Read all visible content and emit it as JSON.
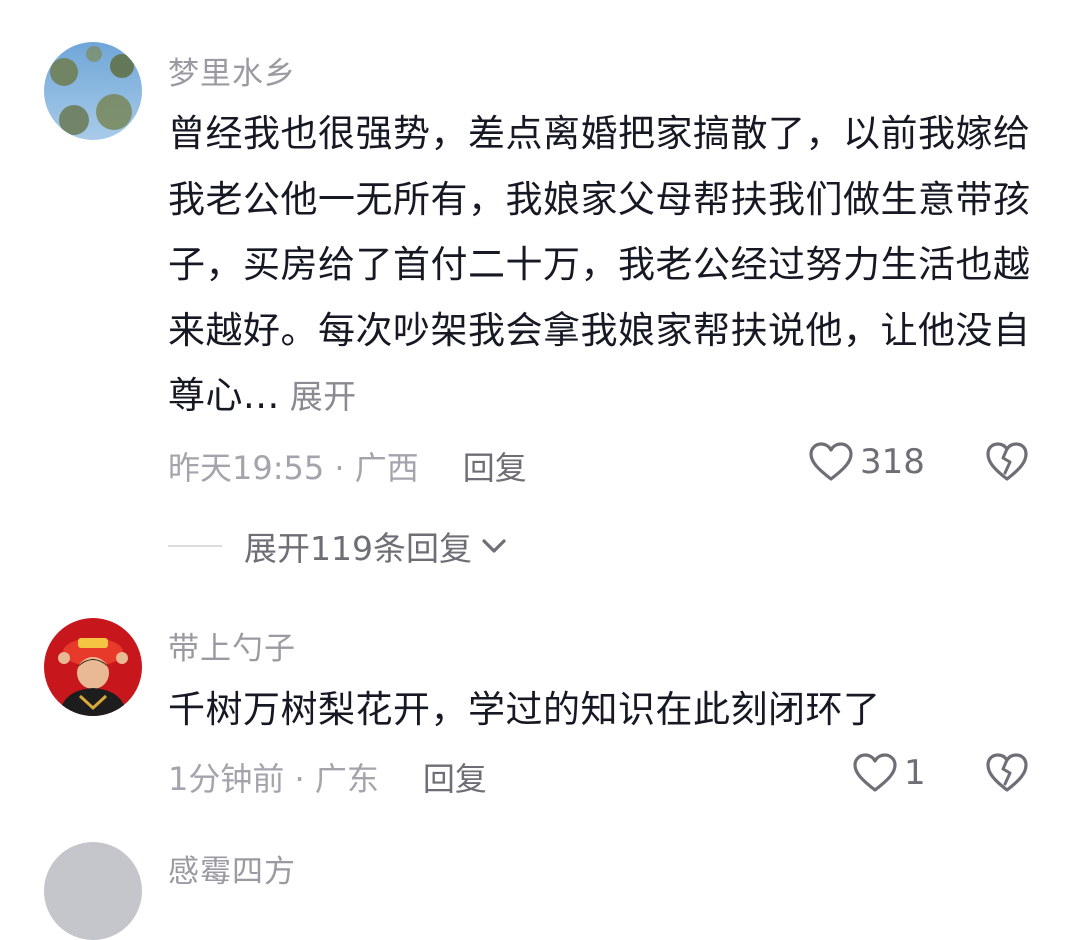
{
  "comments": [
    {
      "username": "梦里水乡",
      "text": "曾经我也很强势，差点离婚把家搞散了，以前我嫁给我老公他一无所有，我娘家父母帮扶我们做生意带孩子，买房给了首付二十万，我老公经过努力生活也越来越好。每次吵架我会拿我娘家帮扶说他，让他没自尊心...",
      "expand_label": "展开",
      "time_location": "昨天19:55 · 广西",
      "reply_label": "回复",
      "likes": "318",
      "replies_toggle": "展开119条回复"
    },
    {
      "username": "带上勺子",
      "text": "千树万树梨花开，学过的知识在此刻闭环了",
      "time_location": "1分钟前 · 广东",
      "reply_label": "回复",
      "likes": "1"
    },
    {
      "username": "感霉四方"
    }
  ],
  "colors": {
    "text": "#161823",
    "secondary": "#9a9aa2",
    "accent_link": "#6e6e76"
  },
  "icons": [
    "heart-icon",
    "broken-heart-icon",
    "chevron-down-icon"
  ]
}
